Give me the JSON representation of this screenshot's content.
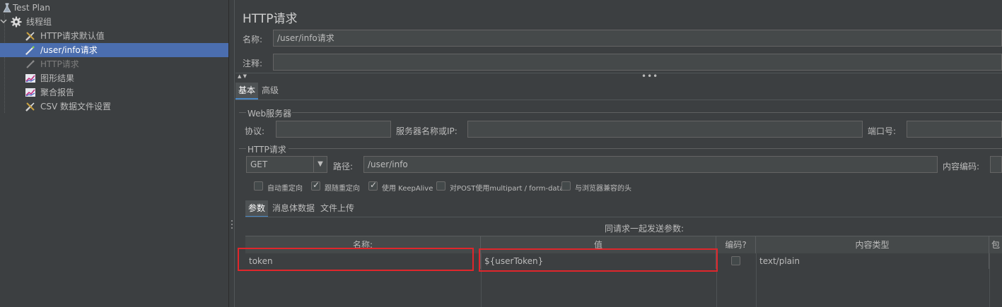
{
  "tree": {
    "items": [
      {
        "label": "Test Plan",
        "icon": "flask-icon"
      },
      {
        "label": "线程组",
        "icon": "gear-icon"
      },
      {
        "label": "HTTP请求默认值",
        "icon": "wrench-icon"
      },
      {
        "label": "/user/info请求",
        "icon": "pipette-icon"
      },
      {
        "label": "HTTP请求",
        "icon": "pipette-icon"
      },
      {
        "label": "图形结果",
        "icon": "graph-icon"
      },
      {
        "label": "聚合报告",
        "icon": "graph-icon"
      },
      {
        "label": "CSV 数据文件设置",
        "icon": "wrench-icon"
      }
    ]
  },
  "panel": {
    "title": "HTTP请求",
    "name_label": "名称:",
    "name_value": "/user/info请求",
    "comment_label": "注释:",
    "comment_value": "",
    "tabs": [
      "基本",
      "高级"
    ],
    "web_server": {
      "group_title": "Web服务器",
      "protocol_label": "协议:",
      "protocol_value": "",
      "server_label": "服务器名称或IP:",
      "server_value": "",
      "port_label": "端口号:",
      "port_value": ""
    },
    "http_request": {
      "group_title": "HTTP请求",
      "method": "GET",
      "path_label": "路径:",
      "path_value": "/user/info",
      "encoding_label": "内容编码:",
      "encoding_value": ""
    },
    "checkboxes": [
      {
        "label": "自动重定向",
        "checked": false
      },
      {
        "label": "跟随重定向",
        "checked": true
      },
      {
        "label": "使用 KeepAlive",
        "checked": true
      },
      {
        "label": "对POST使用multipart / form-data",
        "checked": false
      },
      {
        "label": "与浏览器兼容的头",
        "checked": false
      }
    ],
    "sub_tabs": [
      "参数",
      "消息体数据",
      "文件上传"
    ],
    "params_caption": "同请求一起发送参数:",
    "table": {
      "columns": [
        "名称:",
        "值",
        "编码?",
        "内容类型",
        "包"
      ],
      "rows": [
        {
          "name": "token",
          "value": "${userToken}",
          "encode": false,
          "content_type": "text/plain"
        }
      ]
    }
  },
  "colors": {
    "background": "#3c3f41",
    "selection": "#4b6eaf",
    "highlight_box": "#e0262b",
    "tab_accent": "#4a88c7"
  }
}
